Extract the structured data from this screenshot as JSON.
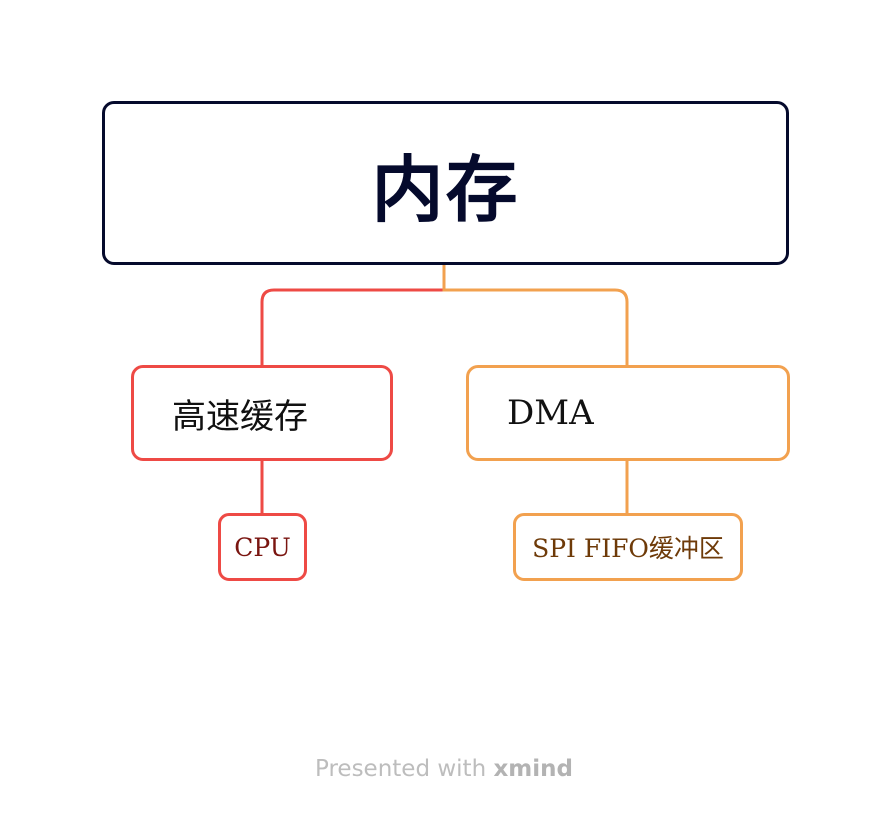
{
  "root": {
    "title": "内存"
  },
  "branches": [
    {
      "label": "高速缓存",
      "color": "#ee4a45",
      "children": [
        {
          "label": "CPU",
          "text_color": "#7a1510"
        }
      ]
    },
    {
      "label": "DMA",
      "color": "#f2a14f",
      "children": [
        {
          "label": "SPI FIFO缓冲区",
          "text_color": "#6e3a08"
        }
      ]
    }
  ],
  "root_color": "#050a2c",
  "footer": {
    "prefix": "Presented with",
    "brand": "xmind"
  }
}
